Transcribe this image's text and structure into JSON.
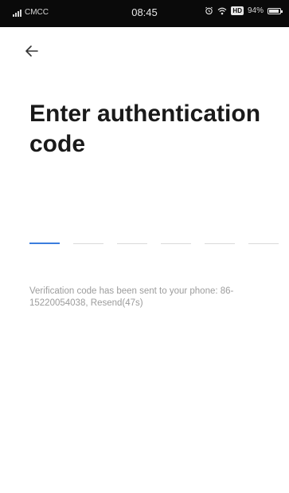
{
  "status_bar": {
    "carrier": "CMCC",
    "time": "08:45",
    "hd_label": "HD",
    "battery_percent": "94%",
    "battery_level": 0.94,
    "icons": [
      "signal-icon",
      "alarm-icon",
      "wifi-icon",
      "battery-icon"
    ]
  },
  "header": {
    "back_icon": "arrow-left-icon"
  },
  "main": {
    "title": "Enter authentication code",
    "code_slots": 6,
    "active_slot": 0,
    "hint_text": "Verification code has been sent to your phone: 86-15220054038,",
    "resend_label": "Resend(47s)"
  },
  "colors": {
    "accent": "#3b7ddd",
    "text_primary": "#1a1a1a",
    "text_muted": "#9c9c9c",
    "status_bar_bg": "#0a0a0a"
  }
}
